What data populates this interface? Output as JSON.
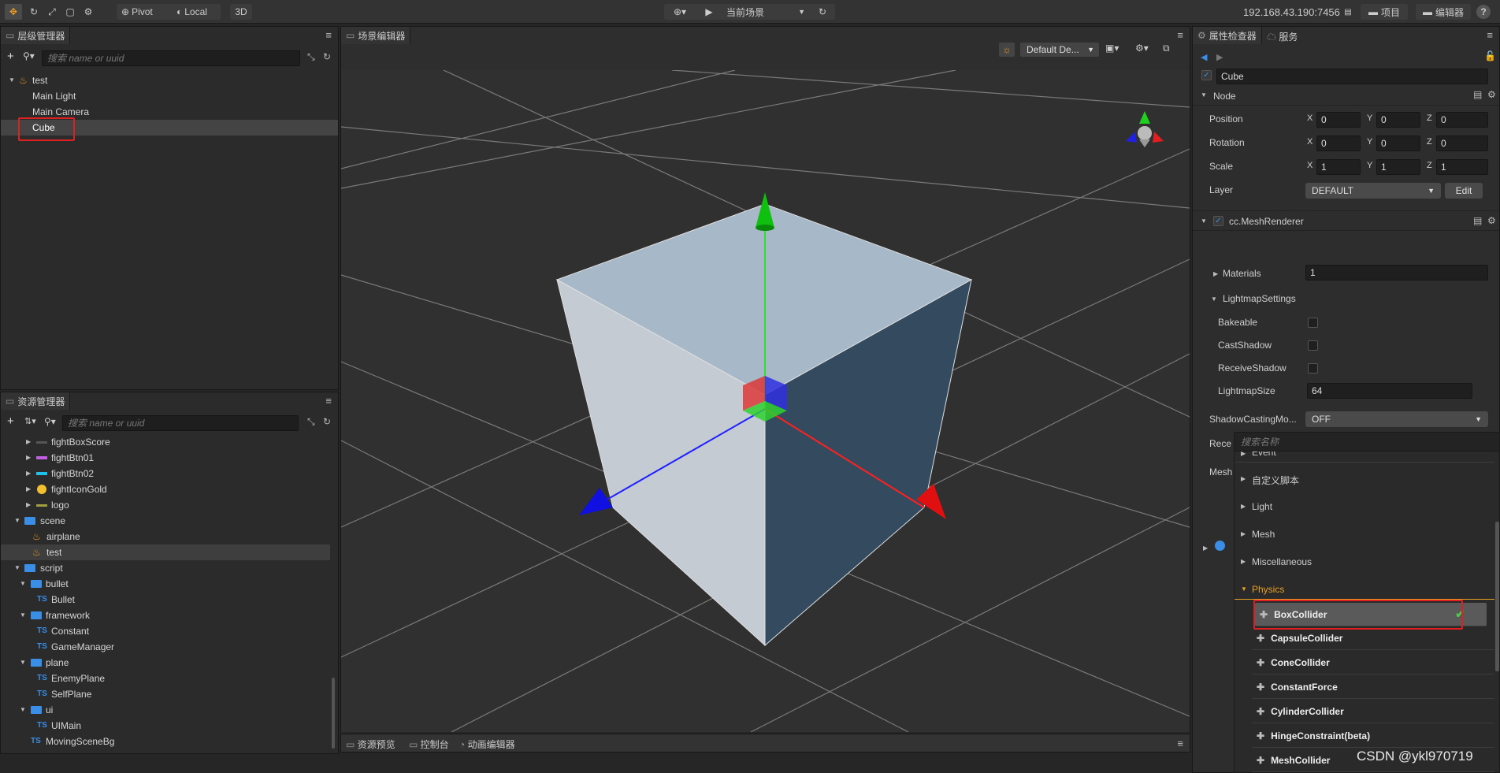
{
  "toolbar": {
    "pivot": "Pivot",
    "local": "Local",
    "mode3d": "3D",
    "scene_select": "当前场景",
    "ip": "192.168.43.190:7456",
    "project_btn": "项目",
    "editor_btn": "编辑器",
    "help": "?"
  },
  "hierarchy": {
    "title": "层级管理器",
    "search_placeholder": "搜索 name or uuid",
    "root": "test",
    "nodes": [
      "Main Light",
      "Main Camera",
      "Cube"
    ]
  },
  "assets": {
    "title": "资源管理器",
    "search_placeholder": "搜索 name or uuid",
    "items": [
      {
        "label": "fightBoxScore"
      },
      {
        "label": "fightBtn01"
      },
      {
        "label": "fightBtn02"
      },
      {
        "label": "fightIconGold"
      },
      {
        "label": "logo"
      },
      {
        "label": "scene"
      },
      {
        "label": "airplane"
      },
      {
        "label": "test"
      },
      {
        "label": "script"
      },
      {
        "label": "bullet"
      },
      {
        "label": "Bullet",
        "prefix": "TS"
      },
      {
        "label": "framework"
      },
      {
        "label": "Constant",
        "prefix": "TS"
      },
      {
        "label": "GameManager",
        "prefix": "TS"
      },
      {
        "label": "plane"
      },
      {
        "label": "EnemyPlane",
        "prefix": "TS"
      },
      {
        "label": "SelfPlane",
        "prefix": "TS"
      },
      {
        "label": "ui"
      },
      {
        "label": "UIMain",
        "prefix": "TS"
      },
      {
        "label": "MovingSceneBg",
        "prefix": "TS"
      }
    ]
  },
  "scene_editor": {
    "title": "场景编辑器",
    "camera_select": "Default De..."
  },
  "bottom_tabs": [
    "资源预览",
    "控制台",
    "动画编辑器"
  ],
  "inspector": {
    "tab_inspector": "属性检查器",
    "tab_services": "服务",
    "node_name": "Cube",
    "node_section": "Node",
    "position": {
      "label": "Position",
      "x": "0",
      "y": "0",
      "z": "0"
    },
    "rotation": {
      "label": "Rotation",
      "x": "0",
      "y": "0",
      "z": "0"
    },
    "scale": {
      "label": "Scale",
      "x": "1",
      "y": "1",
      "z": "1"
    },
    "axis_x": "X",
    "axis_y": "Y",
    "axis_z": "Z",
    "layer": {
      "label": "Layer",
      "value": "DEFAULT",
      "edit": "Edit"
    },
    "mesh_renderer": "cc.MeshRenderer",
    "materials": {
      "label": "Materials",
      "value": "1"
    },
    "lightmap": "LightmapSettings",
    "bakeable": "Bakeable",
    "cast_shadow": "CastShadow",
    "receive_shadow": "ReceiveShadow",
    "lightmap_size": {
      "label": "LightmapSize",
      "value": "64"
    },
    "shadow_casting": {
      "label": "ShadowCastingMo...",
      "value": "OFF"
    },
    "rece_partial": "Rece",
    "mesh_partial": "Mesh"
  },
  "component_menu": {
    "search_placeholder": "搜索名称",
    "event_partial": "Event",
    "categories": [
      "自定义脚本",
      "Light",
      "Mesh",
      "Miscellaneous"
    ],
    "physics": "Physics",
    "items": [
      "BoxCollider",
      "CapsuleCollider",
      "ConeCollider",
      "ConstantForce",
      "CylinderCollider",
      "HingeConstraint(beta)",
      "MeshCollider"
    ]
  },
  "watermark": "CSDN @ykl970719",
  "colors": {
    "highlight": "#e02020",
    "physics": "#e8a020",
    "accent": "#3a8ee6"
  }
}
